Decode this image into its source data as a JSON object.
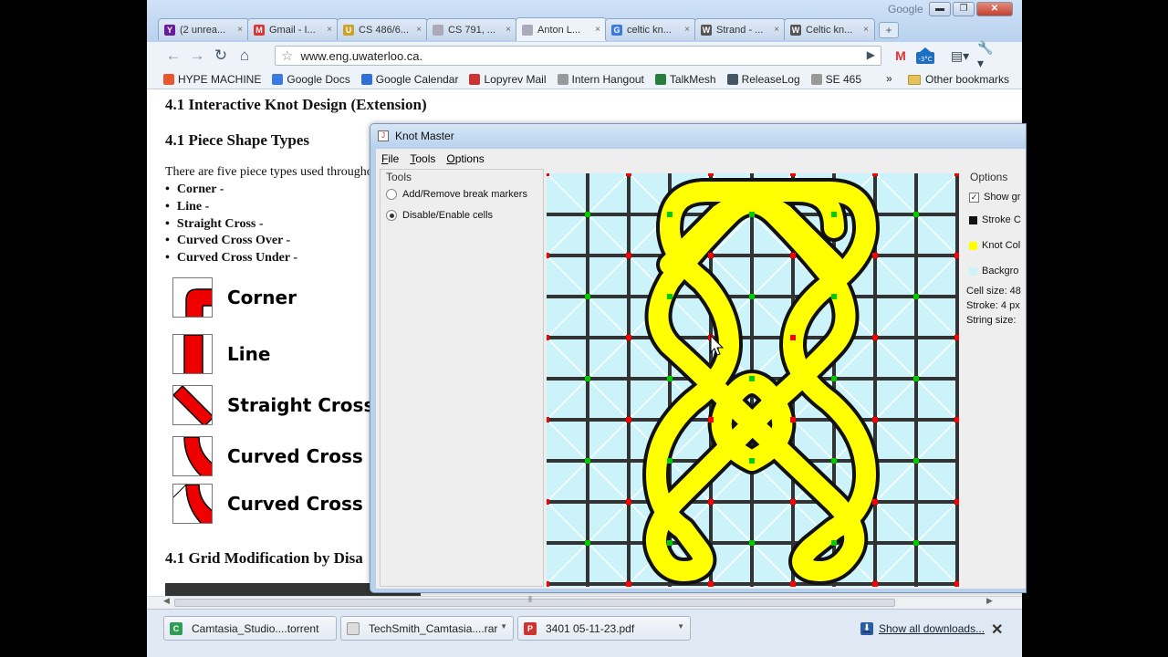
{
  "browser": {
    "google_label": "Google",
    "window_buttons": {
      "minimize": "▬",
      "maximize": "❐",
      "close": "✕"
    },
    "tabs": [
      {
        "label": "(2 unrea...",
        "icon": "yahoo-icon",
        "color": "#6a1b9a",
        "glyph": "Y"
      },
      {
        "label": "Gmail - I...",
        "icon": "gmail-icon",
        "color": "#d33",
        "glyph": "M"
      },
      {
        "label": "CS 486/6...",
        "icon": "uwaterloo-crest-icon",
        "color": "#c9a227",
        "glyph": "U"
      },
      {
        "label": "CS 791, ...",
        "icon": "document-icon",
        "color": "#aab",
        "glyph": ""
      },
      {
        "label": "Anton L...",
        "icon": "document-icon",
        "color": "#aab",
        "glyph": ""
      },
      {
        "label": "celtic kn...",
        "icon": "google-icon",
        "color": "#3b7be0",
        "glyph": "G"
      },
      {
        "label": "Strand - ...",
        "icon": "wikipedia-icon",
        "color": "#555",
        "glyph": "W"
      },
      {
        "label": "Celtic kn...",
        "icon": "wikipedia-icon",
        "color": "#555",
        "glyph": "W"
      }
    ],
    "new_tab": "+",
    "nav": {
      "back": "←",
      "forward": "→",
      "reload": "↻",
      "home": "⌂"
    },
    "url": "www.eng.uwaterloo.ca.",
    "star": "☆",
    "go": "▶",
    "bookmarks": [
      {
        "label": "HYPE MACHINE",
        "color": "#e8562a"
      },
      {
        "label": "Google Docs",
        "color": "#3b7be0"
      },
      {
        "label": "Google Calendar",
        "color": "#2f6fd6"
      },
      {
        "label": "Lopyrev Mail",
        "color": "#c33"
      },
      {
        "label": "Intern Hangout",
        "color": "#999"
      },
      {
        "label": "TalkMesh",
        "color": "#2a7d3b"
      },
      {
        "label": "ReleaseLog",
        "color": "#456"
      },
      {
        "label": "SE 465",
        "color": "#999"
      }
    ],
    "bookmarks_more": "»",
    "other_bookmarks": "Other bookmarks"
  },
  "page": {
    "heading1": "4.1 Interactive Knot Design (Extension)",
    "heading2": "4.1 Piece Shape Types",
    "intro": "There are five piece types used througho",
    "list": [
      "Corner -",
      "Line -",
      "Straight Cross -",
      "Curved Cross Over -",
      "Curved Cross Under -"
    ],
    "pieces": [
      "Corner",
      "Line",
      "Straight Cross",
      "Curved Cross O",
      "Curved Cross U"
    ],
    "heading3": "4.1 Grid Modification by Disa"
  },
  "app": {
    "title": "Knot Master",
    "menu": [
      "File",
      "Tools",
      "Options"
    ],
    "tools_title": "Tools",
    "tools_options": [
      {
        "label": "Add/Remove break markers",
        "selected": false
      },
      {
        "label": "Disable/Enable cells",
        "selected": true
      }
    ],
    "options_title": "Options",
    "show_grid": "Show gr",
    "show_grid_checked": true,
    "stroke_color_label": "Stroke C",
    "knot_color_label": "Knot Col",
    "background_label": "Backgro",
    "stroke_color": "#111111",
    "knot_color": "#ffff00",
    "background_color": "#cbf3f9",
    "cell_size": "Cell size: 48",
    "stroke": "Stroke: 4 px",
    "string_size": "String size:"
  },
  "downloads": {
    "items": [
      {
        "label": "Camtasia_Studio....torrent",
        "color": "#2f9e55",
        "glyph": "C"
      },
      {
        "label": "TechSmith_Camtasia....rar",
        "color": "#ddd",
        "glyph": ""
      },
      {
        "label": "3401 05-11-23.pdf",
        "color": "#c33",
        "glyph": "P"
      }
    ],
    "show_all": "Show all downloads...",
    "close": "✕"
  }
}
